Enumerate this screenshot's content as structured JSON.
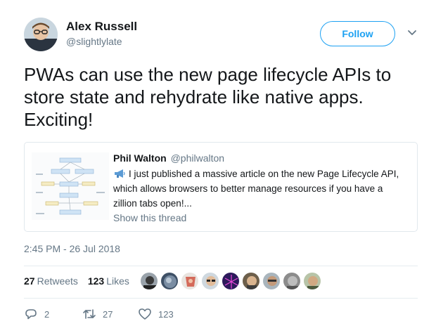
{
  "author": {
    "name": "Alex Russell",
    "handle": "@slightlylate"
  },
  "follow_label": "Follow",
  "tweet": {
    "lines": [
      "PWAs can use the new page lifecycle APIs to",
      "store state and rehydrate like native apps.",
      "Exciting!"
    ]
  },
  "quoted": {
    "name": "Phil Walton",
    "handle": "@philwalton",
    "lines": [
      "I just published a massive article on the new Page Lifecycle API,",
      "which allows browsers to better manage resources if you have a",
      "zillion tabs open!..."
    ],
    "show_thread": "Show this thread"
  },
  "timestamp": "2:45 PM - 26 Jul 2018",
  "stats": {
    "retweets": {
      "count": "27",
      "label": "Retweets"
    },
    "likes": {
      "count": "123",
      "label": "Likes"
    }
  },
  "actions": {
    "reply": "2",
    "retweet": "27",
    "like": "123"
  },
  "colors": {
    "accent": "#1da1f2",
    "muted": "#657786",
    "border": "#e1e8ed"
  },
  "icons": [
    "chevron-down-icon",
    "megaphone-icon",
    "reply-icon",
    "retweet-icon",
    "heart-icon"
  ]
}
